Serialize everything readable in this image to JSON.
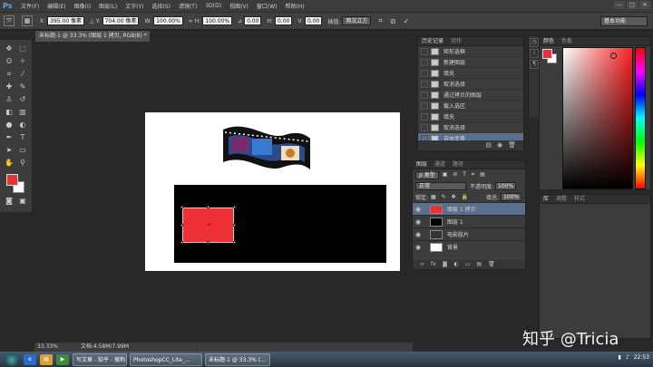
{
  "app": {
    "logo": "Ps",
    "menus": [
      "文件(F)",
      "编辑(E)",
      "图像(I)",
      "图层(L)",
      "文字(Y)",
      "选择(S)",
      "滤镜(T)",
      "3D(D)",
      "视图(V)",
      "窗口(W)",
      "帮助(H)"
    ],
    "window_buttons": [
      "—",
      "□",
      "✕"
    ]
  },
  "options_bar": {
    "x_label": "X:",
    "x_value": "395.00 像素",
    "y_label": "Y:",
    "y_value": "704.00 像素",
    "w_label": "W:",
    "w_value": "100.00%",
    "h_label": "H:",
    "h_value": "100.00%",
    "angle_label": "⊿",
    "angle_value": "0.00",
    "hskew_label": "H:",
    "hskew_value": "0.00",
    "vskew_label": "V:",
    "vskew_value": "0.00",
    "interp_label": "插值:",
    "interp_value": "两次立方",
    "workspace": "基本功能"
  },
  "document": {
    "tab_title": "未标题-1 @ 33.3% (图层 1 拷贝, RGB/8) *",
    "zoom": "33.33%",
    "doc_info": "文档:4.58M/7.99M"
  },
  "history": {
    "tabs": [
      "历史记录",
      "动作"
    ],
    "items": [
      "矩形选框",
      "新建图层",
      "填充",
      "取消选择",
      "通过拷贝的图层",
      "载入选区",
      "填充",
      "取消选择",
      "自由变换"
    ],
    "active_index": 8
  },
  "layers": {
    "tabs": [
      "图层",
      "通道",
      "路径"
    ],
    "filter": "ρ 类型",
    "blend_mode": "正常",
    "opacity_label": "不透明度:",
    "opacity": "100%",
    "lock_label": "锁定:",
    "fill_label": "填充:",
    "fill": "100%",
    "items": [
      {
        "name": "图层 1 拷贝",
        "active": true
      },
      {
        "name": "图层 1",
        "active": false
      },
      {
        "name": "电影胶片",
        "active": false
      },
      {
        "name": "背景",
        "active": false
      }
    ]
  },
  "color_panel": {
    "tabs": [
      "颜色",
      "色板"
    ],
    "foreground": "#ed3034",
    "background": "#ffffff"
  },
  "props_panel": {
    "tabs": [
      "库",
      "调整",
      "样式"
    ]
  },
  "taskbar": {
    "tasks": [
      "写文章 - 知乎 - 搜狗...",
      "PhotoshopCC_Lite_...",
      "未标题-1 @ 33.3% (..."
    ],
    "time": "22:53"
  },
  "watermark": "知乎 @Tricia"
}
